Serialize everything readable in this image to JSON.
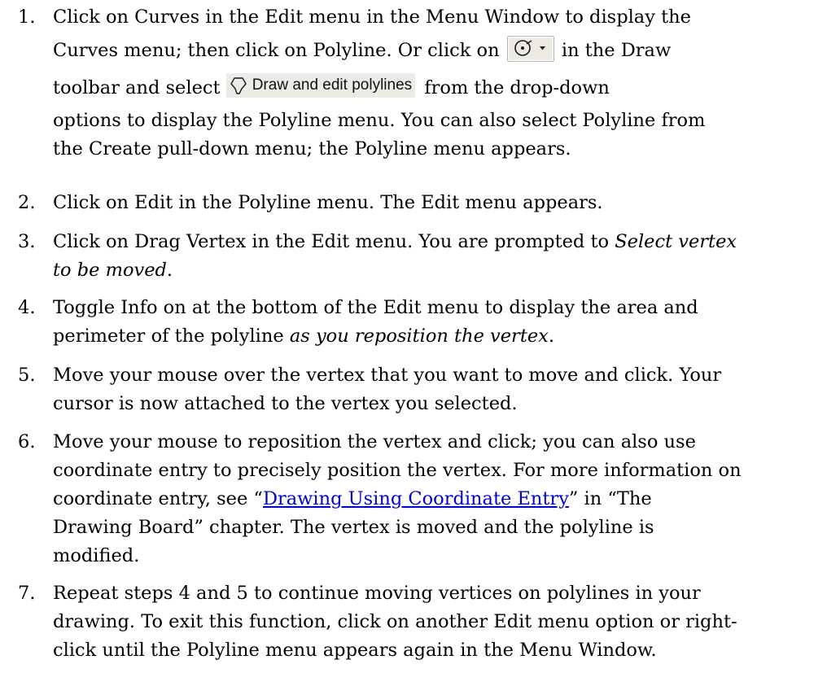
{
  "steps": [
    {
      "number": "1.",
      "line1": "Click on Curves in the Edit menu in the Menu Window to display the",
      "line2_before": "Curves menu; then click on Polyline. Or click on",
      "line2_after": "in the Draw",
      "line3_before": "toolbar and select",
      "option_label": "Draw and edit polylines",
      "line3_after": "from the drop-down",
      "line4": "options to display the Polyline menu. You can also select Polyline from",
      "line5": "the Create pull-down menu; the Polyline menu appears."
    },
    {
      "number": "2.",
      "line1": "Click on Edit in the Polyline menu. The Edit menu appears."
    },
    {
      "number": "3.",
      "line1_before": "Click on Drag Vertex in the Edit menu. You are prompted to",
      "line1_em": "Select vertex",
      "line2_em": "to be moved",
      "line2_after": "."
    },
    {
      "number": "4.",
      "line1": "Toggle Info on at the bottom of the Edit menu to display the area and",
      "line2_before": "perimeter of the polyline",
      "line2_em": "as you reposition the vertex",
      "line2_after": "."
    },
    {
      "number": "5.",
      "line1": "Move your mouse over the vertex that you want to move and click. Your",
      "line2": "cursor is now attached to the vertex you selected."
    },
    {
      "number": "6.",
      "line1": "Move your mouse to reposition the vertex and click; you can also use",
      "line2": "coordinate entry to precisely position the vertex. For more information on",
      "line3_before": "coordinate entry, see “",
      "link_text": "Drawing Using Coordinate Entry",
      "line3_after": "” in “The",
      "line4": "Drawing Board” chapter. The vertex is moved and the polyline is",
      "line5": "modified."
    },
    {
      "number": "7.",
      "line1": "Repeat steps 4 and 5 to continue moving vertices on polylines in your",
      "line2": "drawing. To exit this function, click on another Edit menu option or right-",
      "line3": "click until the Polyline menu appears again in the Menu Window."
    }
  ],
  "icons": {
    "circle_tool": "circle-tool-dropdown-icon",
    "polyline_tool": "polyline-icon"
  },
  "colors": {
    "link": "#0000cc",
    "toolbar_bg": "#eceae2"
  }
}
